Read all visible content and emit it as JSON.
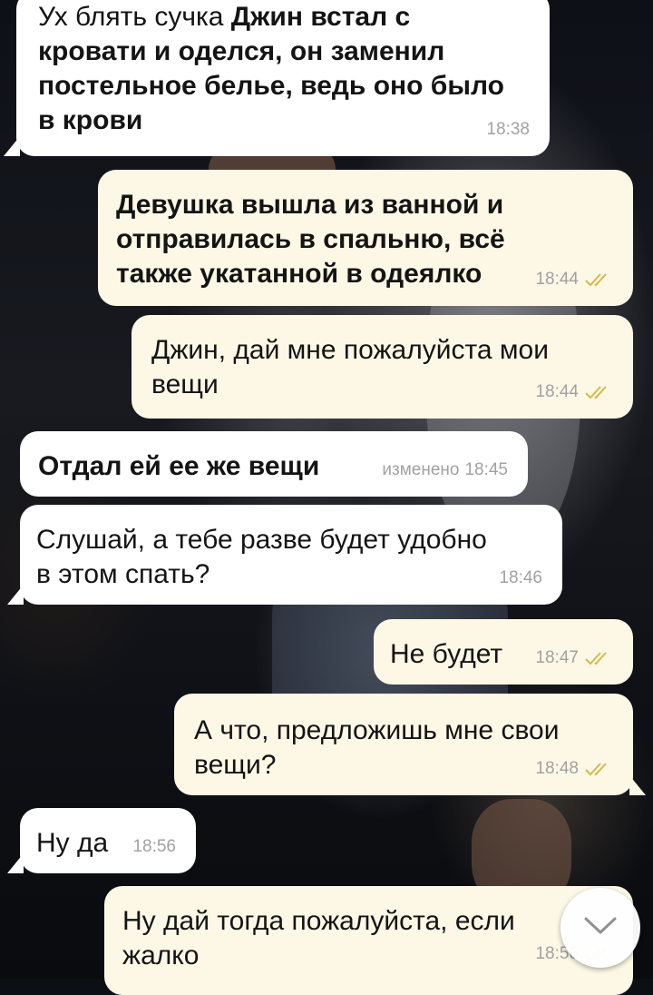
{
  "messages": [
    {
      "id": "m1",
      "dir": "in",
      "text_plain": "Ух блять сучка ",
      "text_bold_1": "Джин встал с",
      "text_bold_2": "кровати и оделся, он заменил",
      "text_bold_3": "постельное белье, ведь оно было",
      "text_bold_4": "в крови",
      "time": "18:38"
    },
    {
      "id": "m2",
      "dir": "out",
      "lines": [
        "Девушка вышла из ванной и",
        "отправилась в спальню, всё",
        "также укатанной в одеялко"
      ],
      "time": "18:44",
      "read": true
    },
    {
      "id": "m3",
      "dir": "out",
      "lines": [
        "Джин, дай мне пожалуйста мои",
        "вещи"
      ],
      "time": "18:44",
      "read": true
    },
    {
      "id": "m4",
      "dir": "in",
      "lines": [
        "Отдал ей ее же вещи"
      ],
      "edited_label": "изменено",
      "time": "18:45"
    },
    {
      "id": "m5",
      "dir": "in",
      "lines": [
        "Слушай, а тебе разве будет удобно",
        "в этом спать?"
      ],
      "time": "18:46"
    },
    {
      "id": "m6",
      "dir": "out",
      "lines": [
        "Не будет"
      ],
      "time": "18:47",
      "read": true
    },
    {
      "id": "m7",
      "dir": "out",
      "lines": [
        "А что, предложишь мне свои",
        "вещи?"
      ],
      "time": "18:48",
      "read": true
    },
    {
      "id": "m8",
      "dir": "in",
      "lines": [
        "Ну да"
      ],
      "time": "18:56"
    },
    {
      "id": "m9",
      "dir": "out",
      "lines": [
        "Ну дай тогда пожалуйста, если",
        "жалко"
      ],
      "time": "18:56",
      "read": true
    }
  ],
  "scroll_button": {
    "icon": "chevron-down-icon"
  },
  "colors": {
    "incoming": "#ffffff",
    "outgoing": "#fdf8e6",
    "check": "#d7b84a",
    "meta": "#a1a1a1"
  }
}
